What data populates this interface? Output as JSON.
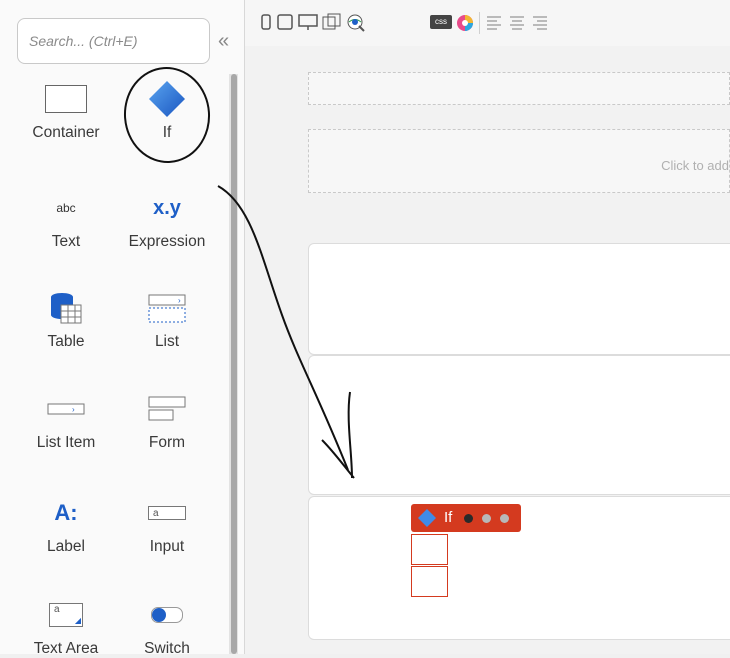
{
  "toolbox": {
    "search_placeholder": "Search... (Ctrl+E)",
    "collapse_icon": "double-chevron-left",
    "widgets": [
      {
        "label": "Container",
        "icon": "container-icon"
      },
      {
        "label": "If",
        "icon": "if-diamond-icon"
      },
      {
        "label": "Text",
        "icon": "abc-text-icon",
        "glyph": "abc"
      },
      {
        "label": "Expression",
        "icon": "expression-icon",
        "glyph": "x.y"
      },
      {
        "label": "Table",
        "icon": "table-icon"
      },
      {
        "label": "List",
        "icon": "list-icon"
      },
      {
        "label": "List Item",
        "icon": "list-item-icon"
      },
      {
        "label": "Form",
        "icon": "form-icon"
      },
      {
        "label": "Label",
        "icon": "label-icon",
        "glyph": "A:"
      },
      {
        "label": "Input",
        "icon": "input-icon",
        "glyph": "a"
      },
      {
        "label": "Text Area",
        "icon": "text-area-icon",
        "glyph": "a"
      },
      {
        "label": "Switch",
        "icon": "switch-icon"
      }
    ]
  },
  "toolbar": {
    "icons": [
      "phone-icon",
      "tablet-icon",
      "desktop-icon",
      "device-resize-icon",
      "preview-globe-icon",
      "css-icon",
      "theme-palette-icon",
      "align-left-icon",
      "align-center-icon",
      "align-right-icon"
    ],
    "css_label": "css"
  },
  "canvas": {
    "placeholder_hint": "Click to add",
    "if_widget": {
      "label": "If"
    }
  },
  "colors": {
    "if_tag": "#d43a1f",
    "accent_blue": "#1e5fc7"
  }
}
